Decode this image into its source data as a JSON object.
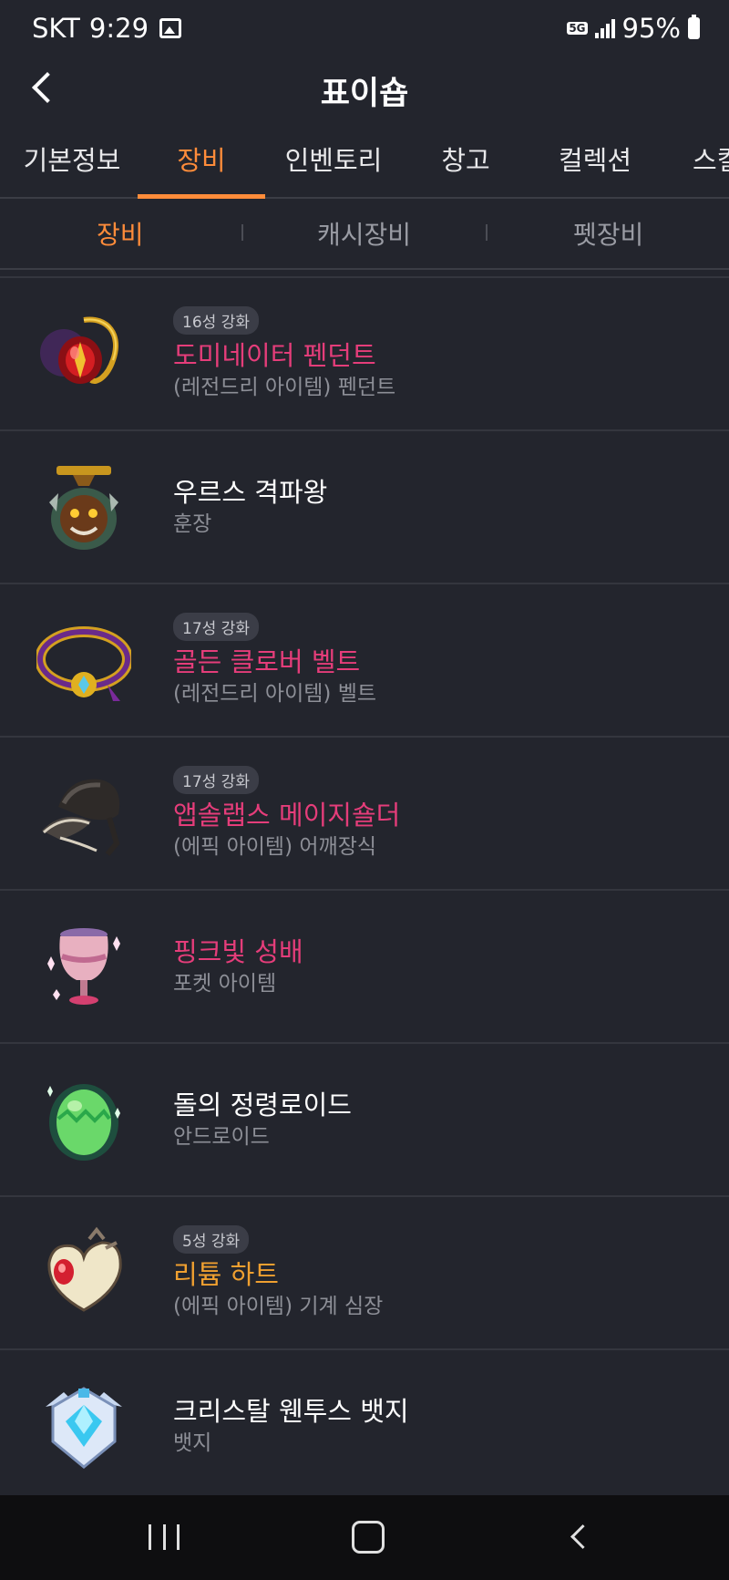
{
  "status_bar": {
    "carrier": "SKT",
    "time": "9:29",
    "network": "5G",
    "battery": "95%"
  },
  "header": {
    "title": "표이숍"
  },
  "tabs": [
    {
      "label": "기본정보",
      "active": false
    },
    {
      "label": "장비",
      "active": true
    },
    {
      "label": "인벤토리",
      "active": false
    },
    {
      "label": "창고",
      "active": false
    },
    {
      "label": "컬렉션",
      "active": false
    },
    {
      "label": "스킬",
      "active": false
    }
  ],
  "subtabs": [
    {
      "label": "장비",
      "active": true
    },
    {
      "label": "캐시장비",
      "active": false
    },
    {
      "label": "펫장비",
      "active": false
    }
  ],
  "items": [
    {
      "badge": "16성 강화",
      "name": "도미네이터 펜던트",
      "desc": "(레전드리 아이템) 펜던트",
      "name_color": "#e53d7a",
      "icon": "pendant-icon"
    },
    {
      "badge": "",
      "name": "우르스 격파왕",
      "desc": "훈장",
      "name_color": "#ffffff",
      "icon": "medal-icon"
    },
    {
      "badge": "17성 강화",
      "name": "골든 클로버 벨트",
      "desc": "(레전드리 아이템) 벨트",
      "name_color": "#e53d7a",
      "icon": "belt-icon"
    },
    {
      "badge": "17성 강화",
      "name": "앱솔랩스 메이지숄더",
      "desc": "(에픽 아이템) 어깨장식",
      "name_color": "#e53d7a",
      "icon": "shoulder-icon"
    },
    {
      "badge": "",
      "name": "핑크빛 성배",
      "desc": "포켓 아이템",
      "name_color": "#e53d7a",
      "icon": "grail-icon"
    },
    {
      "badge": "",
      "name": "돌의 정령로이드",
      "desc": "안드로이드",
      "name_color": "#ffffff",
      "icon": "egg-icon"
    },
    {
      "badge": "5성 강화",
      "name": "리튬 하트",
      "desc": "(에픽 아이템) 기계 심장",
      "name_color": "#f0a030",
      "icon": "heart-icon"
    },
    {
      "badge": "",
      "name": "크리스탈 웬투스 뱃지",
      "desc": "뱃지",
      "name_color": "#ffffff",
      "icon": "badge-icon"
    }
  ],
  "colors": {
    "background": "#23252d",
    "accent": "#ff8c3a",
    "divider": "#34363e"
  }
}
